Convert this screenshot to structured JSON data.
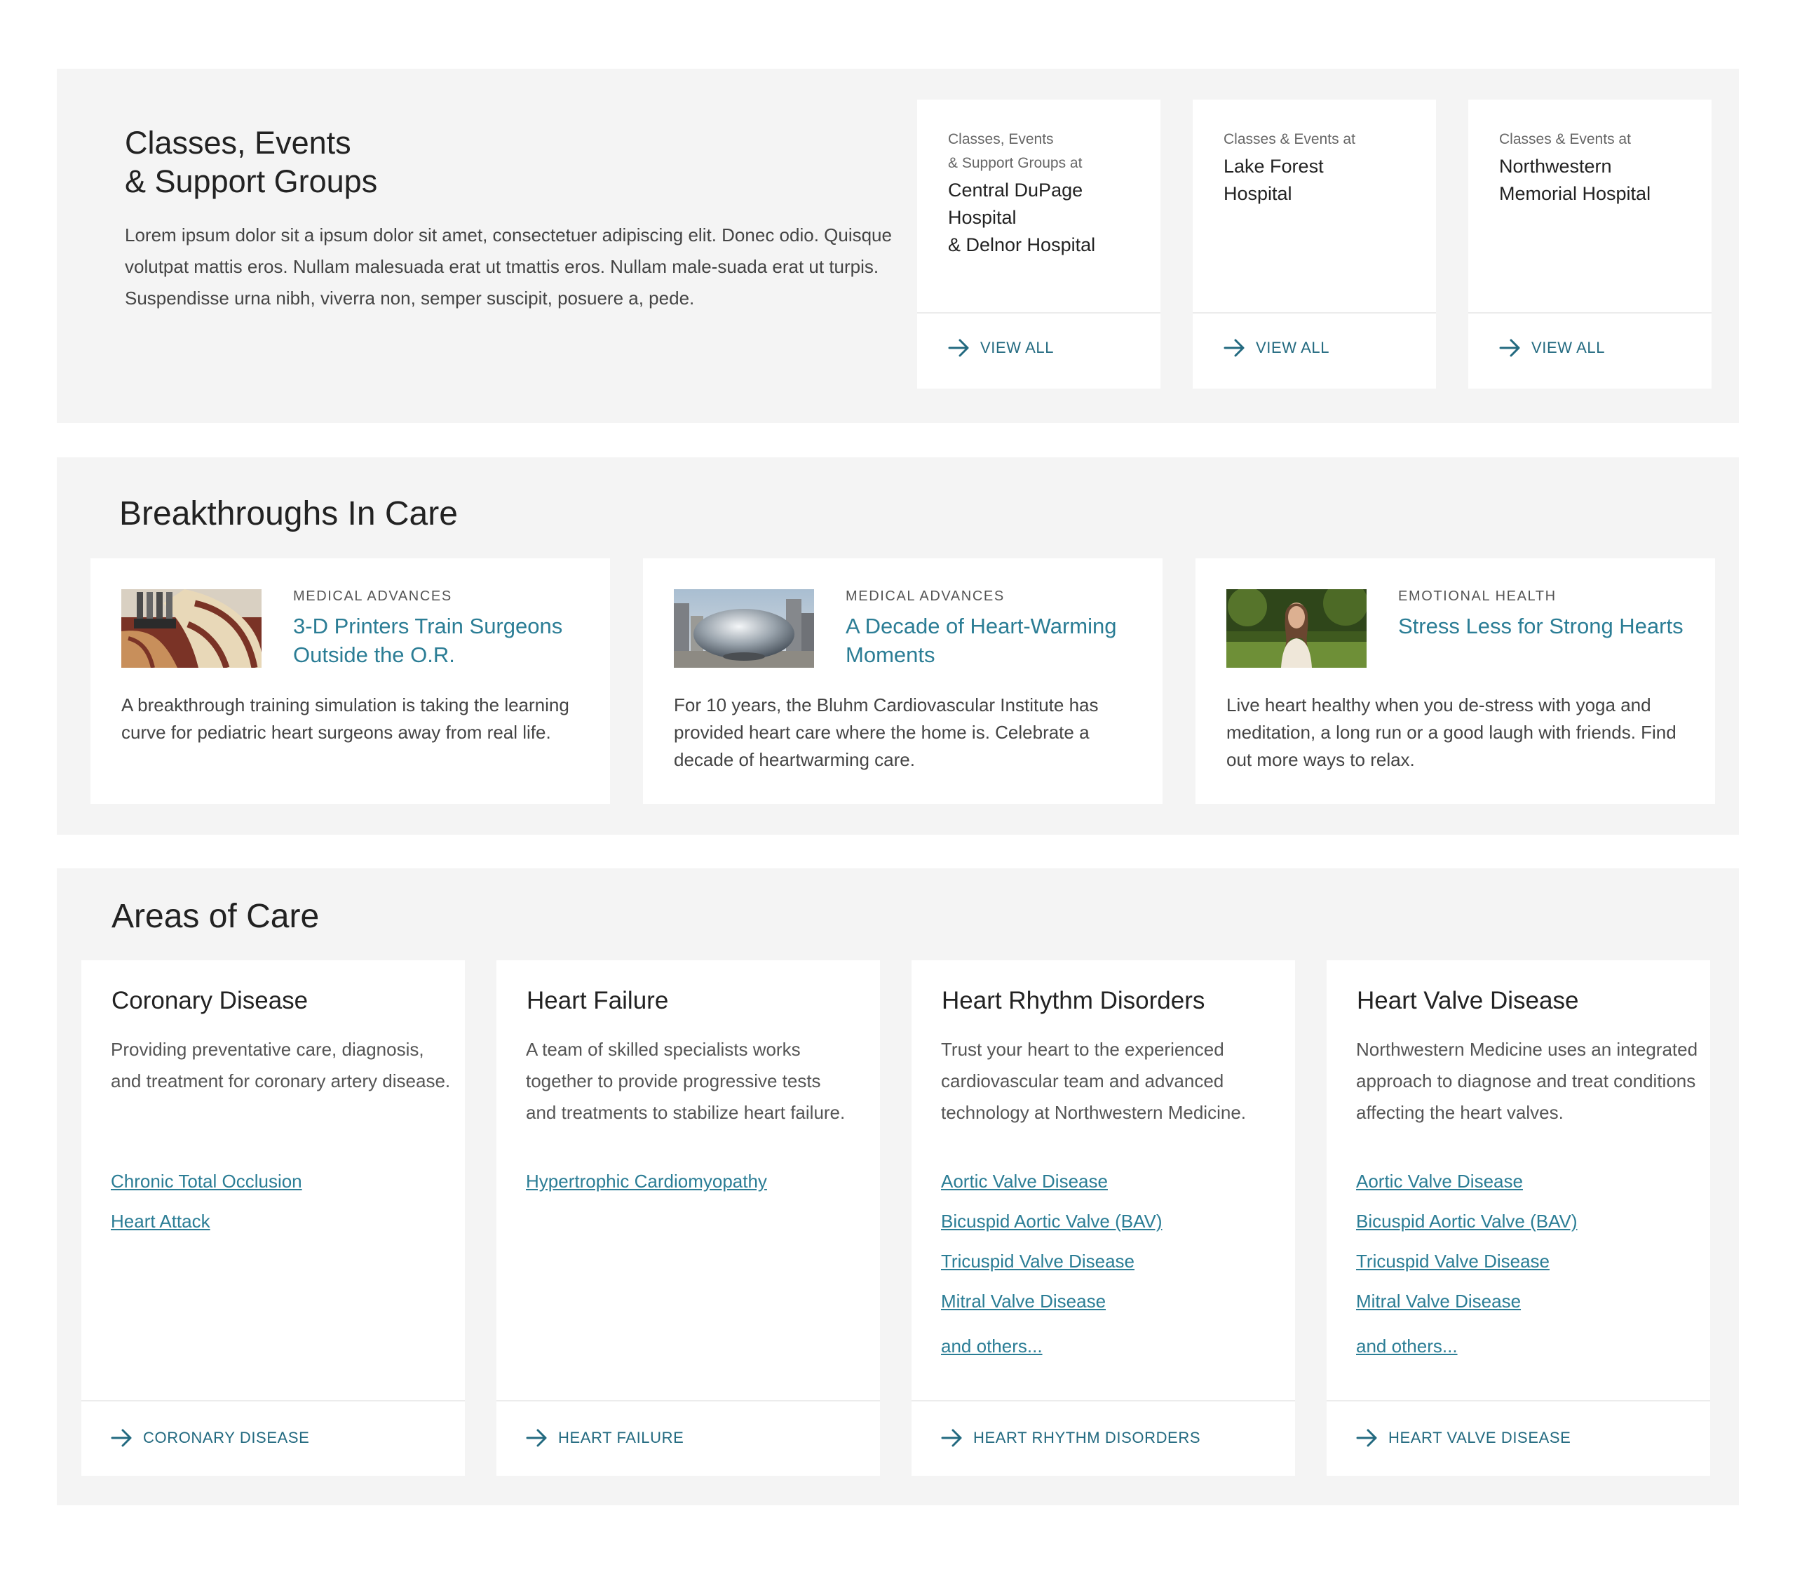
{
  "classes": {
    "title_line1": "Classes, Events",
    "title_line2": "& Support Groups",
    "text": "Lorem ipsum dolor sit a ipsum dolor sit amet, consectetuer adipiscing elit. Donec odio. Quisque volutpat mattis eros. Nullam malesuada erat ut tmattis eros. Nullam male-suada erat ut turpis. Suspendisse urna nibh, viverra non, semper suscipit, posuere a, pede.",
    "locations": [
      {
        "pre_line1": "Classes, Events",
        "pre_line2": "& Support Groups at",
        "name_line1": "Central DuPage",
        "name_line2": "Hospital",
        "name_line3": "& Delnor Hospital",
        "link": "VIEW ALL"
      },
      {
        "pre_line1": "Classes & Events at",
        "pre_line2": "",
        "name_line1": "Lake Forest",
        "name_line2": "Hospital",
        "name_line3": "",
        "link": "VIEW ALL"
      },
      {
        "pre_line1": "Classes & Events at",
        "pre_line2": "",
        "name_line1": "Northwestern",
        "name_line2": "Memorial Hospital",
        "name_line3": "",
        "link": "VIEW ALL"
      }
    ]
  },
  "breakthroughs": {
    "title": "Breakthroughs In Care",
    "articles": [
      {
        "category": "MEDICAL ADVANCES",
        "title_line1": "3-D Printers Train Surgeons",
        "title_line2": "Outside the O.R.",
        "description": "A breakthrough training simulation is taking the learning curve for pediatric heart surgeons away from real life.",
        "image": "3d-printed-heart-model"
      },
      {
        "category": "MEDICAL ADVANCES",
        "title_line1": "A Decade of Heart-Warming",
        "title_line2": "Moments",
        "description": "For 10 years, the Bluhm Cardiovascular Institute has provided heart care where the home is. Celebrate a decade of heartwarming care.",
        "image": "cloud-gate-sculpture"
      },
      {
        "category": "EMOTIONAL HEALTH",
        "title_line1": "Stress Less for Strong Hearts",
        "title_line2": "",
        "description": "Live heart healthy when you de-stress with yoga and meditation, a long run or a good laugh with friends. Find out more ways to relax.",
        "image": "woman-relaxing-outdoors"
      }
    ]
  },
  "areas": {
    "title": "Areas of Care",
    "cards": [
      {
        "title": "Coronary Disease",
        "description": "Providing preventative care, diagnosis, and treatment for coronary artery disease.",
        "links": [
          "Chronic Total Occlusion",
          "Heart Attack"
        ],
        "cta": "CORONARY DISEASE"
      },
      {
        "title": "Heart Failure",
        "description": "A team of skilled specialists works together to provide progressive tests and treatments to stabilize heart failure.",
        "links": [
          "Hypertrophic Cardiomyopathy"
        ],
        "cta": "HEART FAILURE"
      },
      {
        "title": "Heart Rhythm Disorders",
        "description": "Trust your heart to the experienced cardiovascular team and advanced technology at Northwestern Medicine.",
        "links": [
          "Aortic Valve Disease",
          "Bicuspid Aortic Valve (BAV)",
          "Tricuspid Valve Disease",
          "Mitral Valve Disease",
          "and others..."
        ],
        "cta": "HEART RHYTHM DISORDERS"
      },
      {
        "title": "Heart Valve Disease",
        "description": "Northwestern Medicine uses an integrated approach to diagnose and treat conditions affecting the heart valves.",
        "links": [
          "Aortic Valve Disease",
          "Bicuspid Aortic Valve (BAV)",
          "Tricuspid Valve Disease",
          "Mitral Valve Disease",
          "and others..."
        ],
        "cta": "HEART VALVE DISEASE"
      }
    ]
  },
  "colors": {
    "accent": "#236a80",
    "link": "#2b7d95",
    "panel": "#f4f4f4",
    "card": "#ffffff"
  },
  "icons": {
    "cta_arrow": "arrow-right-icon"
  }
}
